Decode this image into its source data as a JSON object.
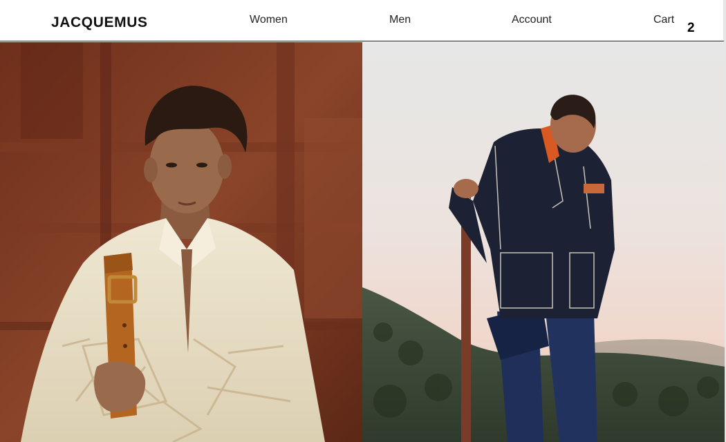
{
  "header": {
    "logo": "JACQUEMUS",
    "nav": {
      "women": "Women",
      "men": "Men",
      "account": "Account",
      "cart": "Cart"
    },
    "cart_count": "2"
  },
  "colors": {
    "header_background": "#ffffff",
    "header_border": "#1a1a1a",
    "text": "#222222"
  },
  "hero": {
    "left": {
      "icon": "photo-women-model-linen-shirt"
    },
    "right": {
      "icon": "photo-men-model-denim-jacket"
    }
  }
}
